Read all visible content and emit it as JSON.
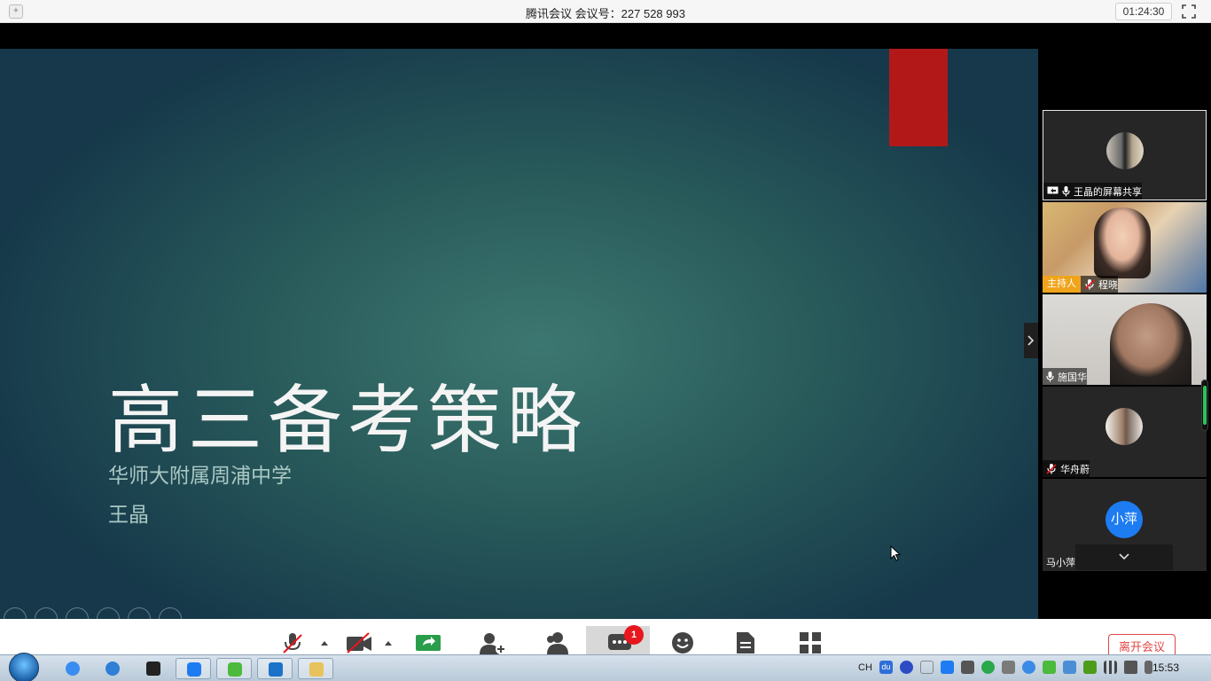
{
  "window": {
    "title": "腾讯会议 会议号：227 528 993",
    "timer": "01:24:30"
  },
  "slide": {
    "title": "高三备考策略",
    "subtitle": "华师大附属周浦中学",
    "presenter": "王晶"
  },
  "participants": [
    {
      "name": "王晶的屏幕共享",
      "mic": "on",
      "sharing": true
    },
    {
      "name": "程晓",
      "mic": "muted",
      "role": "主持人"
    },
    {
      "name": "施国华",
      "mic": "on"
    },
    {
      "name": "华舟蔚",
      "mic": "muted"
    },
    {
      "name": "马小萍",
      "avatar_text": "小萍"
    }
  ],
  "toolbar": {
    "chat_badge": "1",
    "leave_label": "离开会议",
    "icons": [
      "mic-muted-icon",
      "camera-off-icon",
      "share-screen-icon",
      "invite-icon",
      "members-icon",
      "chat-icon",
      "reaction-icon",
      "document-icon",
      "apps-icon"
    ]
  },
  "taskbar": {
    "tray_lang": "CH",
    "tray_ime": "du",
    "clock": "15:53"
  },
  "colors": {
    "accent_red": "#b31818",
    "host_badge": "#f0a41c",
    "leave": "#e04646",
    "avatar_blue": "#1d7cf2"
  }
}
